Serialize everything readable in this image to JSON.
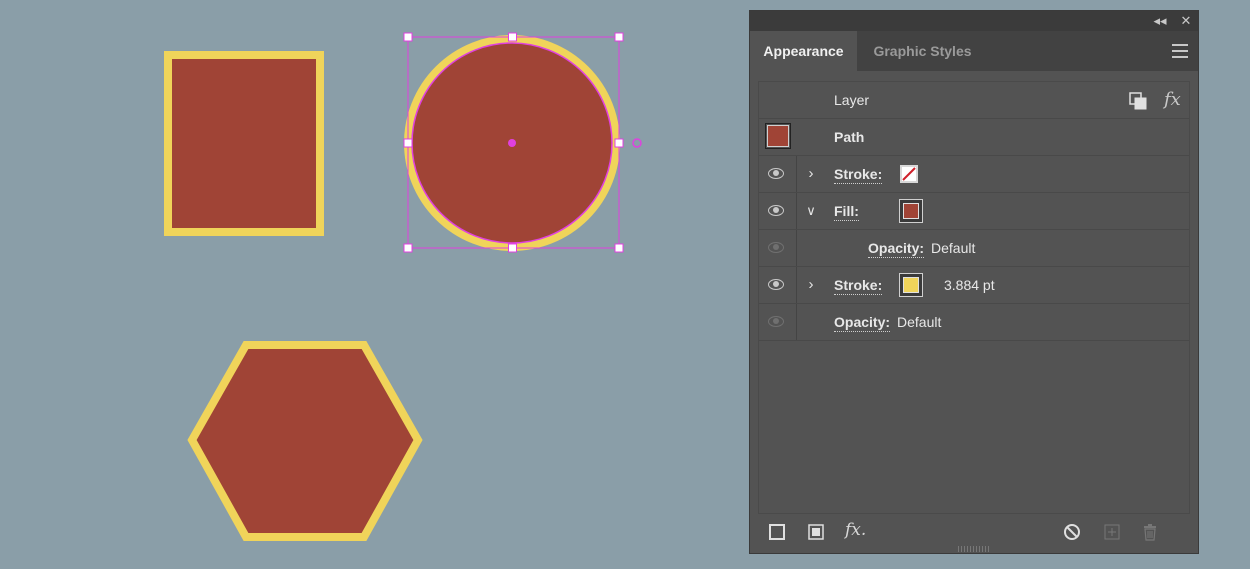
{
  "canvas": {
    "background": "#8a9ea8",
    "fill_color": "#a04436",
    "stroke_color": "#f0d45a",
    "selection_color": "#e040e0"
  },
  "panel": {
    "tabs": [
      {
        "label": "Appearance",
        "active": true
      },
      {
        "label": "Graphic Styles",
        "active": false
      }
    ],
    "titlebar_icons": [
      "collapse-icon",
      "close-icon"
    ],
    "menu_icon": "panel-menu-icon",
    "layer": {
      "label": "Layer",
      "icons": [
        "layer-stack-icon",
        "fx-icon"
      ],
      "fx_glyph": "fx"
    },
    "path": {
      "label": "Path",
      "thumb_color": "#a04436"
    },
    "attributes": [
      {
        "type": "stroke",
        "label": "Stroke:",
        "swatch": "none",
        "visible": true,
        "expanded": false,
        "value": ""
      },
      {
        "type": "fill",
        "label": "Fill:",
        "swatch": "#a04436",
        "visible": true,
        "expanded": true,
        "value": ""
      },
      {
        "type": "opacity",
        "label": "Opacity:",
        "value": "Default",
        "visible": false,
        "indented": true
      },
      {
        "type": "stroke",
        "label": "Stroke:",
        "swatch": "#f0d45a",
        "visible": true,
        "expanded": false,
        "value": "3.884 pt"
      },
      {
        "type": "opacity",
        "label": "Opacity:",
        "value": "Default",
        "visible": false,
        "indented": false
      }
    ],
    "bottom_buttons": [
      "add-new-stroke-icon",
      "add-new-fill-icon",
      "add-new-effect-icon",
      "clear-appearance-icon",
      "duplicate-item-icon",
      "delete-item-icon"
    ],
    "fx_button_glyph": "fx."
  }
}
